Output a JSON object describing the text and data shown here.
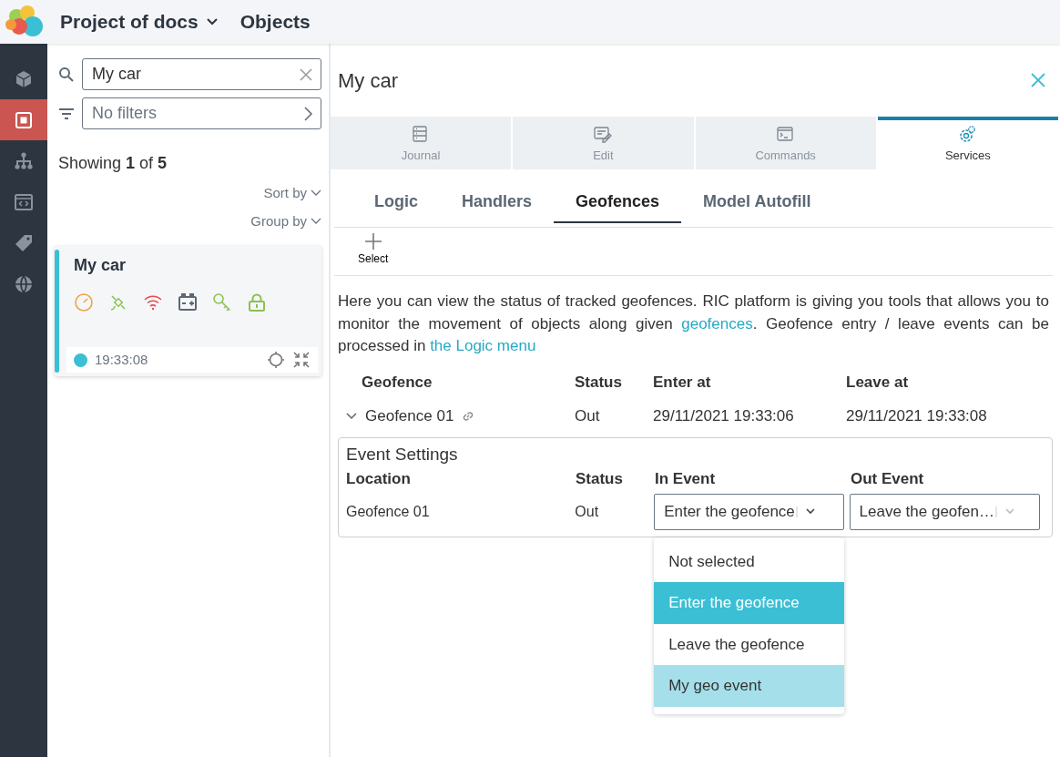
{
  "header": {
    "project": "Project of docs",
    "section": "Objects"
  },
  "sidebar": {
    "items": [
      {
        "selected": false
      },
      {
        "selected": true
      },
      {
        "selected": false
      },
      {
        "selected": false
      },
      {
        "selected": false
      },
      {
        "selected": false
      }
    ]
  },
  "search": {
    "value": "My car"
  },
  "filter": {
    "placeholder": "No filters"
  },
  "showing": "Showing **1** of **5**",
  "sort_by": "Sort by",
  "group_by": "Group by",
  "object_card": {
    "name": "My car",
    "status_icons": [
      {
        "color": "#f0a34a"
      },
      {
        "color": "#8cc152"
      },
      {
        "color": "#e84c4c"
      },
      {
        "color": "#5b6773"
      },
      {
        "color": "#8cc152"
      },
      {
        "color": "#8cc152"
      }
    ],
    "online": true,
    "time": "19:33:08"
  },
  "detail": {
    "title": "My car",
    "tabs": [
      {
        "label": "Journal",
        "selected": false
      },
      {
        "label": "Edit",
        "selected": false
      },
      {
        "label": "Commands",
        "selected": false
      },
      {
        "label": "Services",
        "selected": true
      }
    ],
    "subtabs": [
      {
        "label": "Logic",
        "selected": false
      },
      {
        "label": "Handlers",
        "selected": false
      },
      {
        "label": "Geofences",
        "selected": true
      },
      {
        "label": "Model Autofill",
        "selected": false
      }
    ],
    "select_button": "Select",
    "description": [
      {
        "kind": "text",
        "text": "Here you can view the status of tracked geofences. RIC platform is giving you tools that allows you to monitor the movement of objects along given "
      },
      {
        "kind": "link",
        "text": "geofences"
      },
      {
        "kind": "text",
        "text": ". Geofence entry / leave events can be processed in "
      },
      {
        "kind": "link",
        "text": "the Logic menu"
      }
    ],
    "table": {
      "columns": [
        "Geofence",
        "Status",
        "Enter at",
        "Leave at"
      ],
      "rows": [
        {
          "expanded": true,
          "geofence": "Geofence 01",
          "status": "Out",
          "enter_at": "29/11/2021 19:33:06",
          "leave_at": "29/11/2021 19:33:08"
        }
      ]
    },
    "event_settings": {
      "title": "Event Settings",
      "columns": [
        "Location",
        "Status",
        "In Event",
        "Out Event"
      ],
      "rows": [
        {
          "location": "Geofence 01",
          "status": "Out",
          "in_event": "Enter the geofence",
          "out_event": "Leave the geofen…"
        }
      ],
      "dropdown": {
        "options": [
          {
            "label": "Not selected",
            "selected": false,
            "highlighted": false
          },
          {
            "label": "Enter the geofence",
            "selected": true,
            "highlighted": false
          },
          {
            "label": "Leave the geofence",
            "selected": false,
            "highlighted": false
          },
          {
            "label": "My geo event",
            "selected": false,
            "highlighted": true
          }
        ]
      }
    }
  }
}
